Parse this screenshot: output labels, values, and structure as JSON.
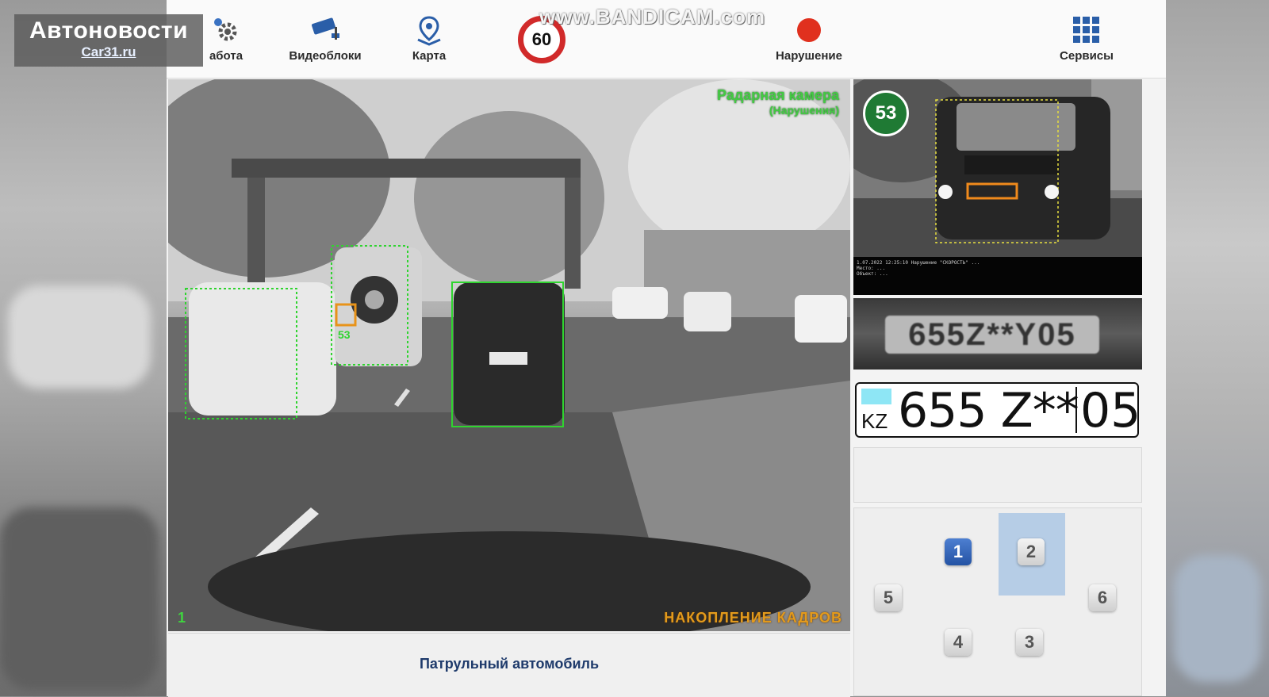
{
  "watermark": "www.BANDICAM.com",
  "site_logo": {
    "title": "Автоновости",
    "url_text": "Car31.ru"
  },
  "nav": {
    "work_label": "абота",
    "video_label": "Видеоблоки",
    "map_label": "Карта",
    "speed_limit": "60",
    "violation_label": "Нарушение",
    "services_label": "Сервисы"
  },
  "main_camera": {
    "title": "Радарная камера",
    "subtitle": "(Нарушения)",
    "index": "1",
    "status": "НАКОПЛЕНИЕ КАДРОВ",
    "tracked_speed_label": "53"
  },
  "caption": "Патрульный автомобиль",
  "snapshot": {
    "speed": "53",
    "meta_lines": [
      "1.07.2022 12:25:10 Нарушение \"СКОРОСТЬ\" ...",
      "Место: ...",
      "Объект: ..."
    ]
  },
  "plate_crop_text": "655Z**Y05",
  "plate": {
    "country": "KZ",
    "number": "655 Z**",
    "region": "05",
    "flag_color": "#8ee6f5"
  },
  "camera_grid": {
    "cells": [
      {
        "label": "1",
        "active": true
      },
      {
        "label": "2",
        "active": false
      },
      {
        "label": "5",
        "active": false
      },
      {
        "label": "6",
        "active": false
      },
      {
        "label": "4",
        "active": false
      },
      {
        "label": "3",
        "active": false
      }
    ]
  },
  "colors": {
    "accent": "#2453a4",
    "detect_green": "#2fd42f",
    "warning_orange": "#e39a1c",
    "alert_red": "#e0301e"
  }
}
